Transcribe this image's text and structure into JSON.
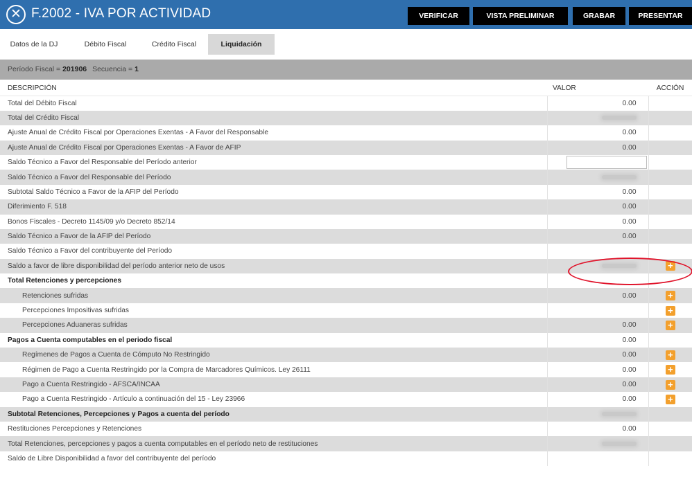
{
  "window": {
    "title": "F.2002 - IVA POR ACTIVIDAD",
    "close_icon": "close-icon"
  },
  "toolbar": {
    "verificar": "VERIFICAR",
    "vista_preliminar": "VISTA PRELIMINAR",
    "grabar": "GRABAR",
    "presentar": "PRESENTAR"
  },
  "tabs": [
    {
      "label": "Datos de la DJ",
      "active": false
    },
    {
      "label": "Débito Fiscal",
      "active": false
    },
    {
      "label": "Crédito Fiscal",
      "active": false
    },
    {
      "label": "Liquidación",
      "active": true
    }
  ],
  "period": {
    "periodo_label": "Período Fiscal =",
    "periodo_value": "201906",
    "secuencia_label": "Secuencia =",
    "secuencia_value": "1"
  },
  "table": {
    "headers": {
      "descripcion": "DESCRIPCIÓN",
      "valor": "VALOR",
      "accion": "ACCIÓN"
    },
    "rows": [
      {
        "desc": "Total del Débito Fiscal",
        "value": "0.00"
      },
      {
        "desc": "Total del Crédito Fiscal",
        "value": ""
      },
      {
        "desc": "Ajuste Anual de Crédito Fiscal por Operaciones Exentas - A Favor del Responsable",
        "value": "0.00"
      },
      {
        "desc": "Ajuste Anual de Crédito Fiscal por Operaciones Exentas - A Favor de AFIP",
        "value": "0.00"
      },
      {
        "desc": "Saldo Técnico a Favor del Responsable del Período anterior",
        "value": ""
      },
      {
        "desc": "Saldo Técnico a Favor del Responsable del Período",
        "value": ""
      },
      {
        "desc": "Subtotal Saldo Técnico a Favor de la AFIP del Período",
        "value": "0.00"
      },
      {
        "desc": "Diferimiento F. 518",
        "value": "0.00"
      },
      {
        "desc": "Bonos Fiscales - Decreto 1145/09 y/o Decreto 852/14",
        "value": "0.00"
      },
      {
        "desc": "Saldo Técnico a Favor de la AFIP del Período",
        "value": "0.00"
      },
      {
        "desc": "Saldo Técnico a Favor del contribuyente del Período",
        "value": ""
      },
      {
        "desc": "Saldo a favor de libre disponibilidad del período anterior neto de usos",
        "value": ""
      },
      {
        "desc": "Total Retenciones y percepciones",
        "value": ""
      },
      {
        "desc": "Retenciones sufridas",
        "value": "0.00"
      },
      {
        "desc": "Percepciones Impositivas sufridas",
        "value": ""
      },
      {
        "desc": "Percepciones Aduaneras sufridas",
        "value": "0.00"
      },
      {
        "desc": "Pagos a Cuenta computables en el periodo fiscal",
        "value": "0.00"
      },
      {
        "desc": "Regímenes de Pagos a Cuenta de Cómputo No Restringido",
        "value": "0.00"
      },
      {
        "desc": "Régimen de Pago a Cuenta Restringido por la Compra de Marcadores Químicos. Ley 26111",
        "value": "0.00"
      },
      {
        "desc": "Pago a Cuenta Restringido - AFSCA/INCAA",
        "value": "0.00"
      },
      {
        "desc": "Pago a Cuenta Restringido - Artículo a continuación del 15 - Ley 23966",
        "value": "0.00"
      },
      {
        "desc": "Subtotal Retenciones, Percepciones y Pagos a cuenta del período",
        "value": ""
      },
      {
        "desc": "Restituciones Percepciones y Retenciones",
        "value": "0.00"
      },
      {
        "desc": "Total Retenciones, percepciones y pagos a cuenta computables en el período neto de restituciones",
        "value": ""
      },
      {
        "desc": "Saldo de Libre Disponibilidad a favor del contribuyente del período",
        "value": ""
      }
    ]
  },
  "colors": {
    "titlebar": "#2f6fae",
    "toolbar_button": "#000000",
    "period_bar": "#aaaaaa",
    "row_alt": "#dcdcdc",
    "add_button": "#f3a02d",
    "highlight": "#e0142b"
  },
  "icons": {
    "add": "plus-icon"
  }
}
